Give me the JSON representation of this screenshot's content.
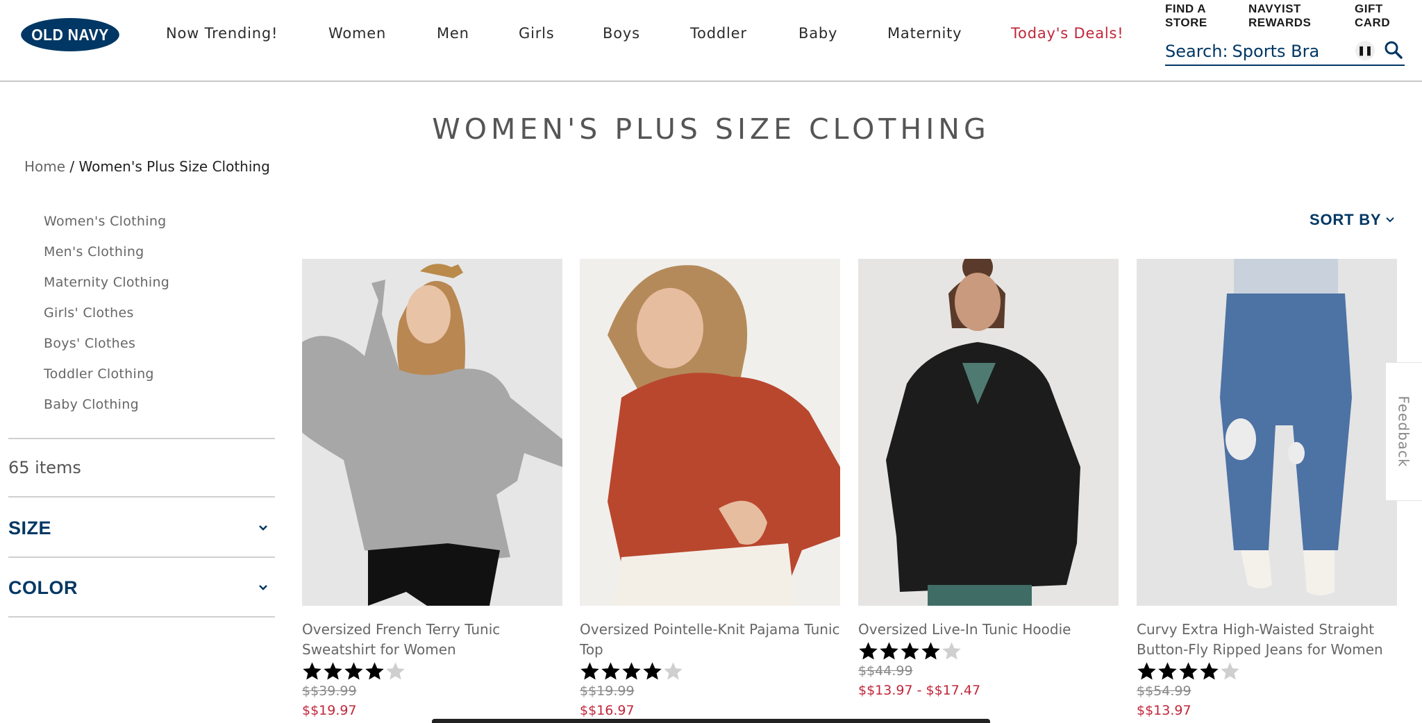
{
  "brand": {
    "logo_text": "OLD NAVY",
    "color": "#003764",
    "deal_color": "#c1263a"
  },
  "nav": {
    "items": [
      "Now Trending!",
      "Women",
      "Men",
      "Girls",
      "Boys",
      "Toddler",
      "Baby",
      "Maternity",
      "Today's Deals!"
    ]
  },
  "utility": {
    "find_store": [
      "FIND A",
      "STORE"
    ],
    "navyist": [
      "NAVYIST",
      "REWARDS"
    ],
    "gift_card": [
      "GIFT",
      "CARD"
    ]
  },
  "search": {
    "label": "Search:",
    "value": "Sports Bra",
    "pause_icon": "pause-icon",
    "search_icon": "magnifier-icon"
  },
  "page": {
    "title": "WOMEN'S PLUS SIZE CLOTHING"
  },
  "breadcrumb": {
    "home": "Home",
    "separator": " / ",
    "current": "Women's Plus Size Clothing"
  },
  "sidebar": {
    "links": [
      "Women's Clothing",
      "Men's Clothing",
      "Maternity Clothing",
      "Girls' Clothes",
      "Boys' Clothes",
      "Toddler Clothing",
      "Baby Clothing"
    ],
    "item_count": "65 items",
    "facets": [
      {
        "label": "SIZE"
      },
      {
        "label": "COLOR"
      }
    ]
  },
  "sort": {
    "label": "SORT BY"
  },
  "feedback": {
    "label": "Feedback"
  },
  "products": [
    {
      "name": "Oversized French Terry Tunic Sweatshirt for Women",
      "rating": 4,
      "price_old": "$$39.99",
      "price_new": "$$19.97"
    },
    {
      "name": "Oversized Pointelle-Knit Pajama Tunic Top",
      "rating": 4,
      "price_old": "$$19.99",
      "price_new": "$$16.97"
    },
    {
      "name": "Oversized Live-In Tunic Hoodie",
      "rating": 4,
      "price_old": "$$44.99",
      "price_new": "$$13.97 - $$17.47"
    },
    {
      "name": "Curvy Extra High-Waisted Straight Button-Fly Ripped Jeans for Women",
      "rating": 4,
      "price_old": "$$54.99",
      "price_new": "$$13.97"
    }
  ]
}
